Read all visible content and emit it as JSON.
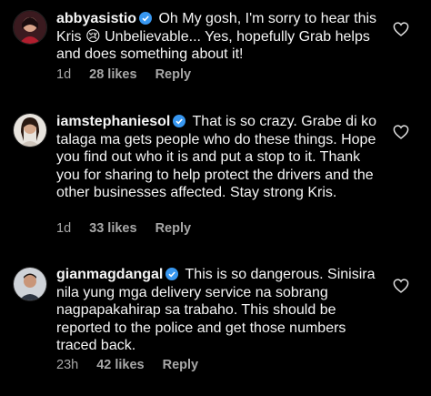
{
  "comments": [
    {
      "username": "abbyasistio",
      "text": "Oh My gosh, I'm sorry to hear this Kris 😢 Unbelievable... Yes, hopefully Grab helps and does something about it!",
      "time": "1d",
      "likes": "28 likes",
      "reply": "Reply"
    },
    {
      "username": "iamstephaniesol",
      "text": "That is so crazy. Grabe di ko talaga ma gets people who do these things. Hope you find out who it is and put a stop to it. Thank you for sharing to help protect the drivers and the other businesses affected. Stay strong Kris.",
      "time": "1d",
      "likes": "33 likes",
      "reply": "Reply"
    },
    {
      "username": "gianmagdangal",
      "text": "This is so dangerous. Sinisira nila yung mga delivery service na sobrang nagpapakahirap sa trabaho. This should be reported to the police and get those numbers traced back.",
      "time": "23h",
      "likes": "42 likes",
      "reply": "Reply"
    }
  ],
  "icons": {
    "verified": "verified-badge-icon",
    "like": "heart-outline-icon"
  },
  "colors": {
    "background": "#000000",
    "text": "#f5f5f5",
    "meta": "#a8a8a8",
    "verified": "#3897f0"
  }
}
